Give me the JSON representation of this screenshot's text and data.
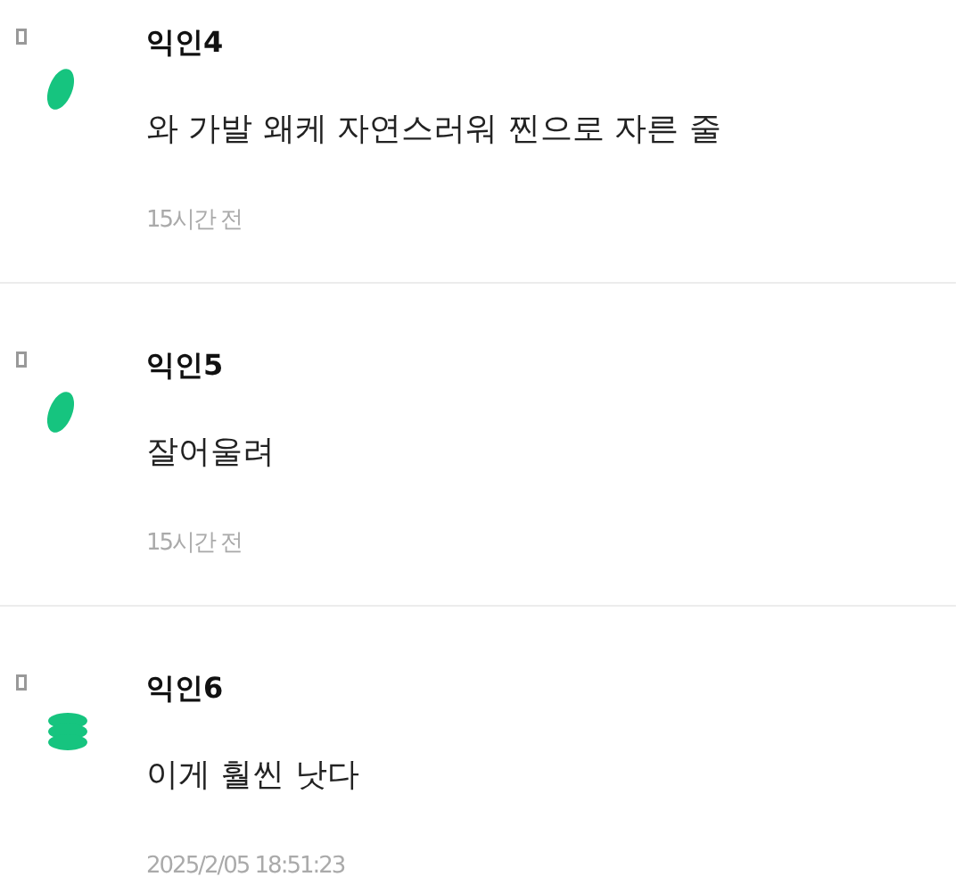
{
  "comments": [
    {
      "author": "익인4",
      "text": "와 가발 왜케 자연스러워 찐으로 자른 줄",
      "time": "15시간 전",
      "kind": "blob"
    },
    {
      "author": "익인5",
      "text": "잘어울려",
      "time": "15시간 전",
      "kind": "blob"
    },
    {
      "author": "익인6",
      "text": "이게 훨씬 낫다",
      "time": "2025/2/05 18:51:23",
      "kind": "stack"
    }
  ]
}
